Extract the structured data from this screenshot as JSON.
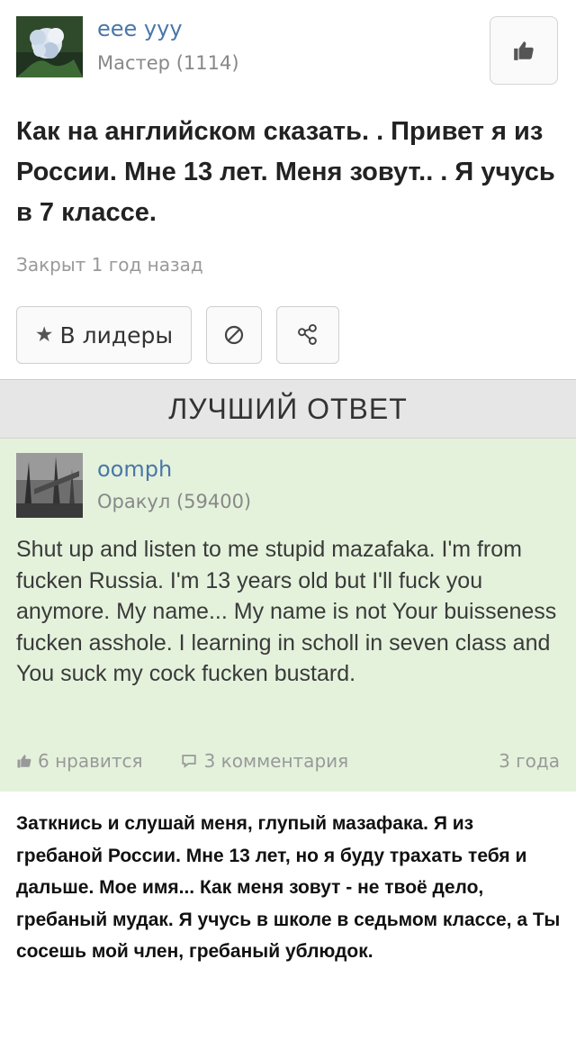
{
  "question": {
    "author": {
      "name": "eee yyy",
      "rank": "Мастер (1114)"
    },
    "title": "Как на английском сказать. . Привет я из России. Мне 13 лет. Меня зовут.. . Я учусь в 7 классе.",
    "status": "Закрыт 1 год назад",
    "actions": {
      "leaders_label": "В лидеры"
    }
  },
  "best_answer": {
    "header": "ЛУЧШИЙ ОТВЕТ",
    "author": {
      "name": "oomph",
      "rank": "Оракул (59400)"
    },
    "text": "Shut up and listen to me stupid mazafaka. I'm from fucken Russia. I'm 13 years old but I'll fuck you anymore. My name... My name is not Your buisseness fucken asshole. I learning in scholl in seven class and You suck my cock fucken bustard.",
    "likes": "6 нравится",
    "comments": "3 комментария",
    "age": "3 года"
  },
  "translation": "Заткнись и слушай меня, глупый мазафака. Я из гребаной России. Мне 13 лет, но я буду трахать тебя и дальше. Мое имя... Как меня зовут - не твоё дело, гребаный мудак. Я учусь в школе в седьмом классе, а Ты сосешь мой член, гребаный ублюдок."
}
